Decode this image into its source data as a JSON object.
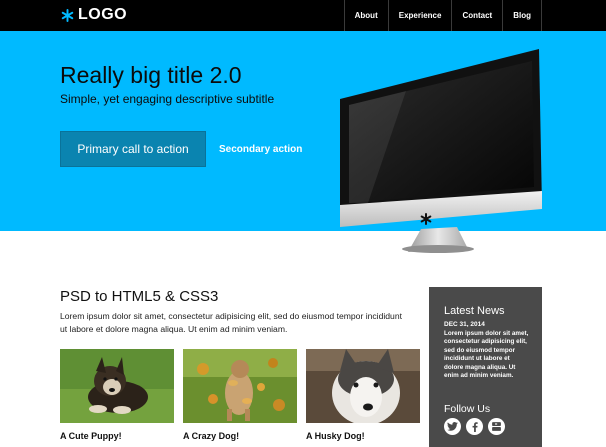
{
  "header": {
    "logo_text": "LOGO",
    "nav": [
      "About",
      "Experience",
      "Contact",
      "Blog"
    ]
  },
  "hero": {
    "title": "Really big title 2.0",
    "subtitle": "Simple, yet engaging descriptive subtitle",
    "primary_cta": "Primary call to action",
    "secondary_cta": "Secondary action"
  },
  "content": {
    "title": "PSD to HTML5 & CSS3",
    "text": "Lorem ipsum dolor sit amet, consectetur adipisicing elit, sed do eiusmod tempor incididunt ut labore et dolore magna aliqua. Ut enim ad minim veniam.",
    "gallery": [
      {
        "caption": "A Cute Puppy!",
        "image": "puppy-photo"
      },
      {
        "caption": "A Crazy Dog!",
        "image": "crazy-dog-photo"
      },
      {
        "caption": "A Husky Dog!",
        "image": "husky-photo"
      }
    ]
  },
  "sidebar": {
    "heading": "Latest News",
    "date": "DEC 31, 2014",
    "text": "Lorem ipsum dolor sit amet, consectetur adipisicing elit, sed do eiusmod tempor incididunt ut labore et dolore magna aliqua. Ut enim ad minim veniam.",
    "follow_heading": "Follow Us",
    "social": [
      "twitter-icon",
      "facebook-icon",
      "youtube-icon"
    ]
  },
  "colors": {
    "hero_bg": "#00baff",
    "topbar_bg": "#000000",
    "primary_button": "#0a84b0",
    "sidebar_bg": "#4a4a4a"
  }
}
